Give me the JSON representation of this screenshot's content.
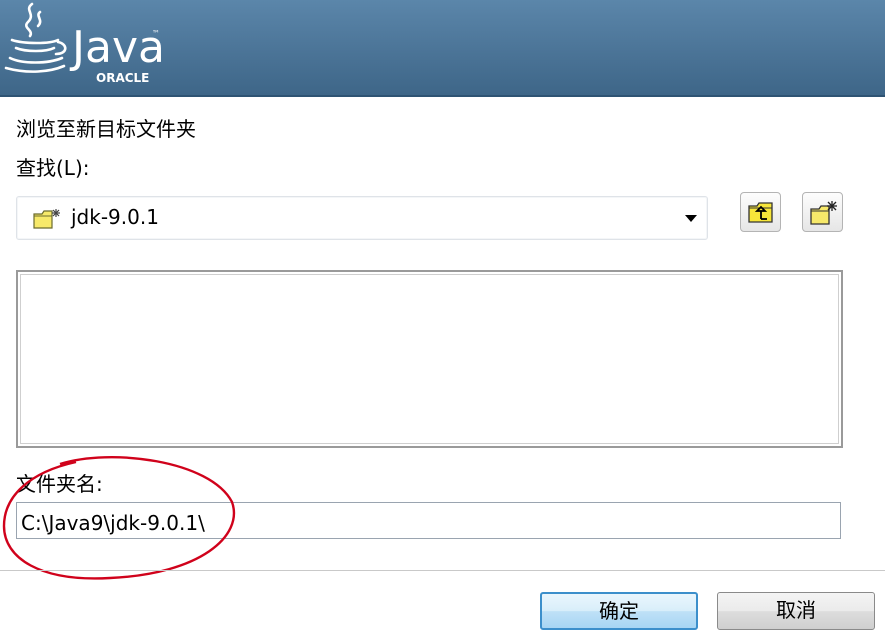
{
  "banner": {
    "brand": "Java",
    "brand_mark": "™",
    "vendor": "ORACLE",
    "logo_icon": "java-cup-icon"
  },
  "dialog": {
    "instruction": "浏览至新目标文件夹",
    "lookin_label": "查找(L):",
    "lookin_value": "jdk-9.0.1",
    "lookin_icon": "folder-icon",
    "up_button_icon": "folder-up-icon",
    "new_folder_button_icon": "new-folder-icon",
    "folder_name_label": "文件夹名:",
    "folder_name_value": "C:\\Java9\\jdk-9.0.1\\"
  },
  "buttons": {
    "ok": "确定",
    "cancel": "取消"
  },
  "colors": {
    "banner": "#4b7497",
    "annotation": "#d0021b",
    "ok_border": "#3c8fcb"
  }
}
